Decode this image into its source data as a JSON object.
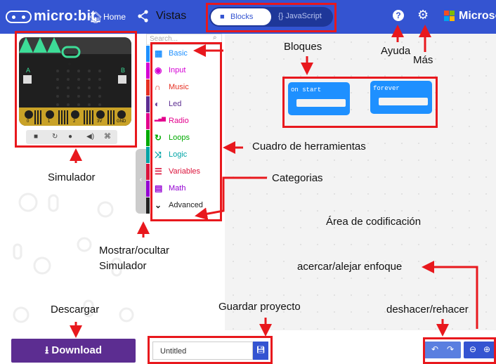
{
  "topbar": {
    "app_name": "micro:bit",
    "home_label": "Home",
    "blocks_label": "Blocks",
    "javascript_label": "JavaScript",
    "help_glyph": "?",
    "settings_glyph": "⚙",
    "brand_text": "Microsoft",
    "colors": {
      "bar": "#3454d1"
    }
  },
  "simulator": {
    "pins": [
      "0",
      "1",
      "2",
      "3V",
      "GND"
    ],
    "controls": [
      "stop-icon",
      "restart-icon",
      "slowmo-icon",
      "mute-icon",
      "fullscreen-icon"
    ]
  },
  "toolbox": {
    "search_placeholder": "Search...",
    "categories": [
      {
        "label": "Basic",
        "color": "#1e90ff",
        "icon": "grid-icon"
      },
      {
        "label": "Input",
        "color": "#d400d4",
        "icon": "target-icon"
      },
      {
        "label": "Music",
        "color": "#e63022",
        "icon": "headphones-icon"
      },
      {
        "label": "Led",
        "color": "#5c2d91",
        "icon": "toggle-icon"
      },
      {
        "label": "Radio",
        "color": "#e3008c",
        "icon": "signal-icon"
      },
      {
        "label": "Loops",
        "color": "#00aa00",
        "icon": "loop-icon"
      },
      {
        "label": "Logic",
        "color": "#00a4a6",
        "icon": "shuffle-icon"
      },
      {
        "label": "Variables",
        "color": "#dc143c",
        "icon": "list-icon"
      },
      {
        "label": "Math",
        "color": "#9400d3",
        "icon": "calculator-icon"
      },
      {
        "label": "Advanced",
        "color": "#222222",
        "icon": "chevron-down-icon"
      }
    ]
  },
  "workspace": {
    "blocks": [
      {
        "label": "on start"
      },
      {
        "label": "forever"
      }
    ]
  },
  "footer": {
    "download_label": "Download",
    "project_name": "Untitled"
  },
  "annotations": {
    "vistas": "Vistas",
    "ayuda": "Ayuda",
    "mas": "Más",
    "bloques": "Bloques",
    "cuadro": "Cuadro de herramientas",
    "categorias": "Categorias",
    "simulador": "Simulador",
    "mostrar_1": "Mostrar/ocultar",
    "mostrar_2": "Simulador",
    "area": "Área de codificación",
    "zoom": "acercar/alejar enfoque",
    "descargar": "Descargar",
    "guardar": "Guardar proyecto",
    "deshacer": "deshacer/rehacer"
  }
}
